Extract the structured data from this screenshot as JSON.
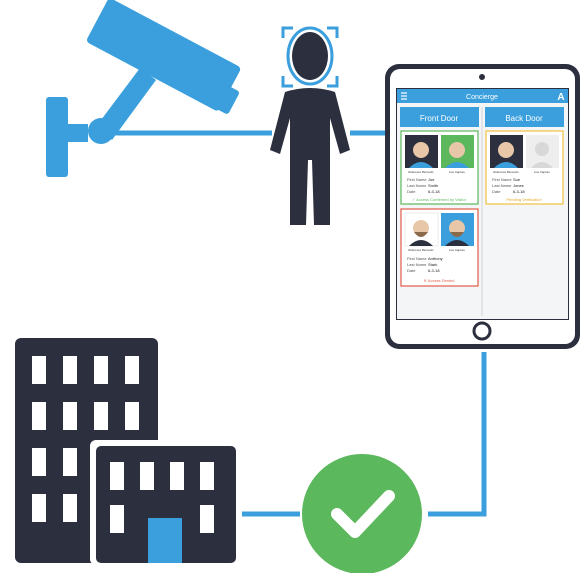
{
  "colors": {
    "accent_blue": "#3a9fdc",
    "dark_navy": "#2b2f3e",
    "success_green": "#5cb85c",
    "denied_red": "#e05a4a",
    "pending_yellow": "#f0c040",
    "tablet_header": "#3a9fdc"
  },
  "tablet": {
    "app_title": "Concierge",
    "menu_icon": "hamburger-icon",
    "logo_icon": "a-logo-icon",
    "columns": [
      {
        "title": "Front Door"
      },
      {
        "title": "Back Door"
      }
    ],
    "cards": [
      {
        "column": "Front Door",
        "ref_label": "Reference Biometric",
        "live_label": "Live Capture",
        "first_name_label": "First Name",
        "first_name": "Joe",
        "last_name_label": "Last Name",
        "last_name": "Smith",
        "date_label": "Date",
        "date": "6-3-18",
        "status": "✓ Access Confirmed by Visitor",
        "status_kind": "confirmed"
      },
      {
        "column": "Back Door",
        "ref_label": "Reference Biometric",
        "live_label": "Live Capture",
        "first_name_label": "First Name",
        "first_name": "Sue",
        "last_name_label": "Last Name",
        "last_name": "Jones",
        "date_label": "Date",
        "date": "6-3-18",
        "status": "Pending Verification",
        "status_kind": "pending"
      },
      {
        "column": "Front Door",
        "ref_label": "Reference Biometric",
        "live_label": "Live Capture",
        "first_name_label": "First Name",
        "first_name": "Anthony",
        "last_name_label": "Last Name",
        "last_name": "Stark",
        "date_label": "Date",
        "date": "6-3-18",
        "status": "✕ Access Denied",
        "status_kind": "denied"
      }
    ]
  },
  "icons": {
    "camera": "security-camera-icon",
    "person": "person-face-scan-icon",
    "building": "office-building-icon",
    "check": "check-circle-icon"
  }
}
